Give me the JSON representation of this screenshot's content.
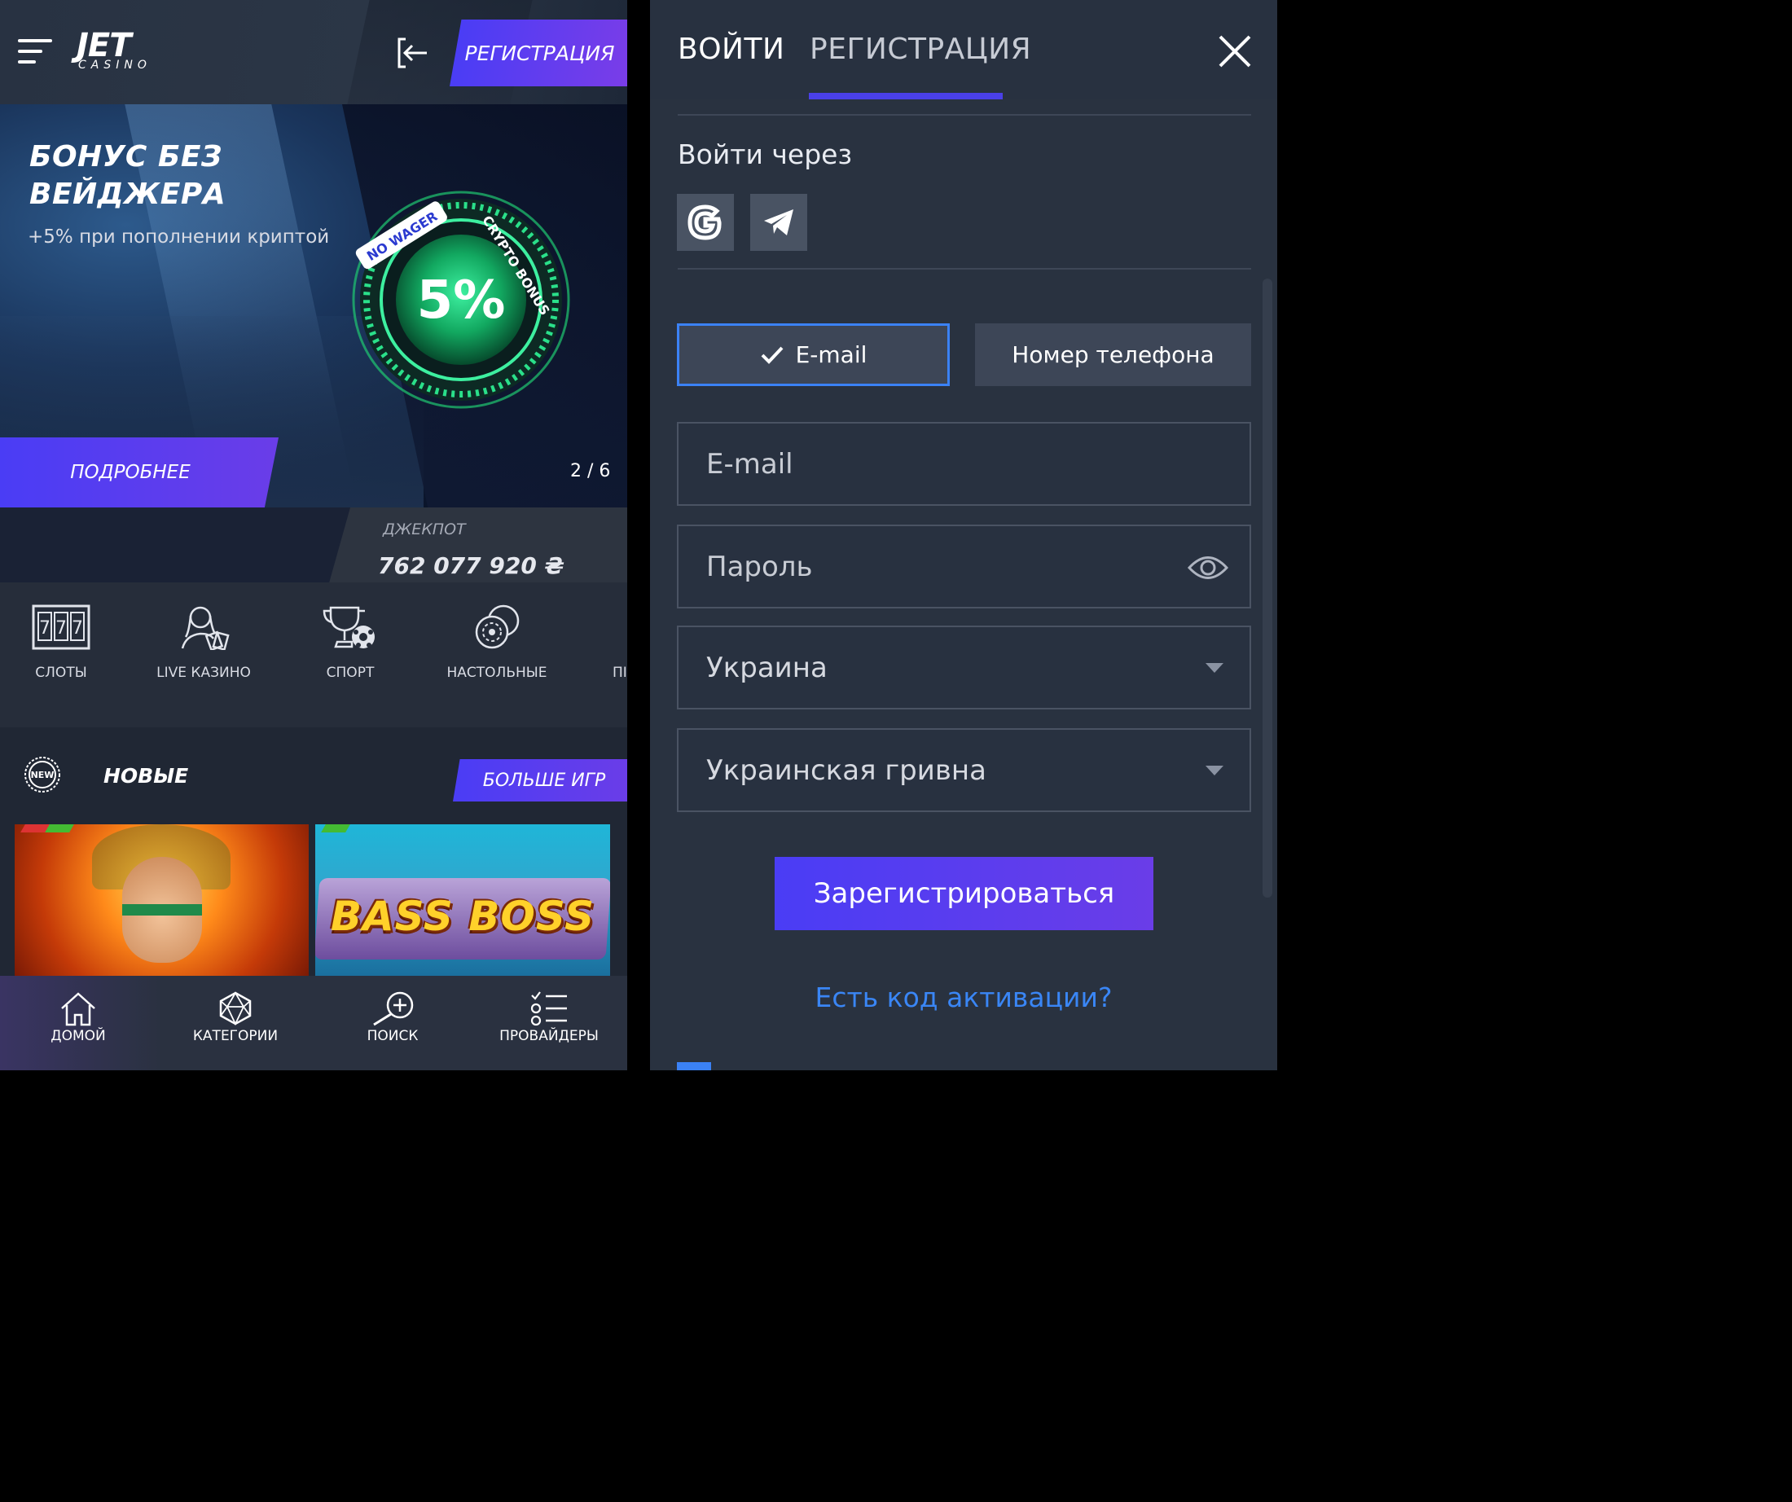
{
  "left": {
    "header": {
      "logo_main": "JET",
      "logo_sub": "CASINO",
      "register_label": "РЕГИСТРАЦИЯ"
    },
    "banner": {
      "title": "БОНУС БЕЗ ВЕЙДЖЕРА",
      "subtitle": "+5% при пополнении криптой",
      "disc_percent": "5%",
      "disc_top": "NO WAGER",
      "disc_side": "CRYPTO BONUS",
      "more_label": "ПОДРОБНЕЕ",
      "counter": "2 / 6"
    },
    "jackpot": {
      "label": "ДЖЕКПОТ",
      "value": "762 077 920 ₴"
    },
    "categories": [
      {
        "label": "СЛОТЫ",
        "icon": "slots-777-icon"
      },
      {
        "label": "LIVE КАЗИНО",
        "icon": "live-dealer-icon"
      },
      {
        "label": "СПОРТ",
        "icon": "trophy-ball-icon"
      },
      {
        "label": "НАСТОЛЬНЫЕ",
        "icon": "casino-chips-icon"
      },
      {
        "label": "ПІ",
        "icon": "partial-icon"
      }
    ],
    "new_section": {
      "badge": "NEW",
      "title": "НОВЫЕ",
      "more_games_label": "БОЛЬШЕ ИГР",
      "games": [
        {
          "title": "",
          "theme": "aztec-queen"
        },
        {
          "title": "BASS BOSS",
          "theme": "fishing"
        }
      ]
    },
    "bottom_nav": [
      {
        "label": "ДОМОЙ",
        "icon": "home-icon"
      },
      {
        "label": "КАТЕГОРИИ",
        "icon": "polyhedron-icon"
      },
      {
        "label": "ПОИСК",
        "icon": "search-plus-icon"
      },
      {
        "label": "ПРОВАЙДЕРЫ",
        "icon": "list-check-icon"
      }
    ]
  },
  "right": {
    "tabs": {
      "login": "ВОЙТИ",
      "register": "РЕГИСТРАЦИЯ",
      "active": "register"
    },
    "via_title": "Войти через",
    "social": [
      {
        "icon": "google-icon"
      },
      {
        "icon": "telegram-icon"
      }
    ],
    "method": {
      "email_label": "E-mail",
      "phone_label": "Номер телефона",
      "selected": "email"
    },
    "fields": {
      "email_placeholder": "E-mail",
      "password_placeholder": "Пароль",
      "country_value": "Украина",
      "currency_value": "Украинская гривна"
    },
    "submit_label": "Зарегистрироваться",
    "activation_link": "Есть код активации?"
  },
  "colors": {
    "accent": "#4a3df5",
    "accent_end": "#6a3de8",
    "link_blue": "#3a86f5",
    "panel_bg": "#293240",
    "selected_border": "#3b82f6"
  }
}
